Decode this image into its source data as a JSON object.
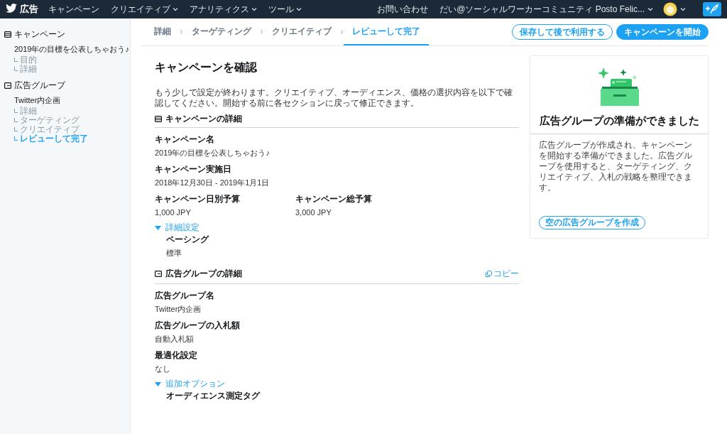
{
  "header": {
    "logo_text": "広告",
    "nav": [
      {
        "label": "キャンペーン",
        "dropdown": false
      },
      {
        "label": "クリエイティブ",
        "dropdown": true
      },
      {
        "label": "アナリティクス",
        "dropdown": true
      },
      {
        "label": "ツール",
        "dropdown": true
      }
    ],
    "contact": "お問い合わせ",
    "account": "だい@ソーシャルワーカーコミュニティ Posto Felic..."
  },
  "sidebar": [
    {
      "kind": "campaign",
      "title": "キャンペーン",
      "name": "2019年の目標を公表しちゃおう♪",
      "children": [
        {
          "label": "目的",
          "selected": false
        },
        {
          "label": "詳細",
          "selected": false
        }
      ]
    },
    {
      "kind": "adgroup",
      "title": "広告グループ",
      "name": "Twitter内企画",
      "children": [
        {
          "label": "詳細",
          "selected": false
        },
        {
          "label": "ターゲティング",
          "selected": false
        },
        {
          "label": "クリエイティブ",
          "selected": false
        },
        {
          "label": "レビューして完了",
          "selected": true
        }
      ]
    }
  ],
  "steps": [
    {
      "label": "詳細",
      "selected": false
    },
    {
      "label": "ターゲティング",
      "selected": false
    },
    {
      "label": "クリエイティブ",
      "selected": false
    },
    {
      "label": "レビューして完了",
      "selected": true
    }
  ],
  "actions": [
    {
      "label": "保存して後で利用する",
      "kind": "outline"
    },
    {
      "label": "キャンペーンを開始",
      "kind": "primary"
    }
  ],
  "page_title": "キャンペーンを確認",
  "intro": "もう少しで設定が終わります。クリエイティブ、オーディエンス、価格の選択内容を以下で確認してください。開始する前に各セクションに戻って修正できます。",
  "sections": [
    {
      "kind": "campaign",
      "title": "キャンペーンの詳細",
      "rows": [
        [
          {
            "label": "キャンペーン名",
            "value": "2019年の目標を公表しちゃおう♪"
          }
        ],
        [
          {
            "label": "キャンペーン実施日",
            "value": "2018年12月30日 - 2019年1月1日"
          }
        ],
        [
          {
            "label": "キャンペーン日別予算",
            "value": "1,000 JPY"
          },
          {
            "label": "キャンペーン総予算",
            "value": "3,000 JPY"
          }
        ]
      ],
      "expander": {
        "label": "詳細設定",
        "expanded": true,
        "fields": [
          {
            "label": "ペーシング",
            "value": "標準"
          }
        ]
      }
    },
    {
      "kind": "adgroup",
      "title": "広告グループの詳細",
      "copy": "コピー",
      "rows": [
        [
          {
            "label": "広告グループ名",
            "value": "Twitter内企画"
          }
        ],
        [
          {
            "label": "広告グループの入札額",
            "value": "自動入札額"
          }
        ],
        [
          {
            "label": "最適化設定",
            "value": "なし"
          }
        ]
      ],
      "expander": {
        "label": "追加オプション",
        "expanded": true,
        "fields": [
          {
            "label": "オーディエンス測定タグ"
          }
        ]
      }
    }
  ],
  "card": {
    "title": "広告グループの準備ができました",
    "body": "広告グループが作成され、キャンペーンを開始する準備ができました。広告グループを使用すると、ターゲティング、クリエイティブ、入札の戦略を整理できます。",
    "button": "空の広告グループを作成"
  }
}
